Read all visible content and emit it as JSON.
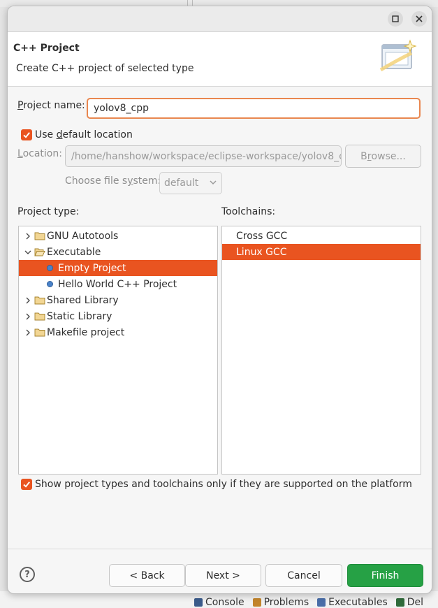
{
  "dialog": {
    "title": "C++ Project",
    "description": "Create C++ project of selected type"
  },
  "project_name": {
    "label_prefix": "P",
    "label_rest": "roject name:",
    "value": "yolov8_cpp"
  },
  "default_location": {
    "checked": true,
    "label_pre": "Use ",
    "label_u": "d",
    "label_post": "efault location"
  },
  "location": {
    "label_u": "L",
    "label_rest": "ocation:",
    "value": "/home/hanshow/workspace/eclipse-workspace/yolov8_c",
    "browse_u": "r",
    "browse_pre": "B",
    "browse_post": "owse..."
  },
  "file_system": {
    "label_pre": "Choose file s",
    "label_u": "y",
    "label_post": "stem:",
    "value": "default"
  },
  "project_type": {
    "label": "Project type:",
    "items": [
      {
        "label": "GNU Autotools",
        "kind": "folder",
        "expanded": false,
        "level": 0,
        "selected": false
      },
      {
        "label": "Executable",
        "kind": "folder",
        "expanded": true,
        "level": 0,
        "selected": false
      },
      {
        "label": "Empty Project",
        "kind": "leaf",
        "level": 1,
        "selected": true
      },
      {
        "label": "Hello World C++ Project",
        "kind": "leaf",
        "level": 1,
        "selected": false
      },
      {
        "label": "Shared Library",
        "kind": "folder",
        "expanded": false,
        "level": 0,
        "selected": false
      },
      {
        "label": "Static Library",
        "kind": "folder",
        "expanded": false,
        "level": 0,
        "selected": false
      },
      {
        "label": "Makefile project",
        "kind": "folder",
        "expanded": false,
        "level": 0,
        "selected": false
      }
    ]
  },
  "toolchains": {
    "label": "Toolchains:",
    "items": [
      {
        "label": "Cross GCC",
        "selected": false
      },
      {
        "label": "Linux GCC",
        "selected": true
      }
    ]
  },
  "supported_only": {
    "checked": true,
    "label": "Show project types and toolchains only if they are supported on the platform"
  },
  "buttons": {
    "help": "?",
    "back": "< Back",
    "next": "Next >",
    "cancel": "Cancel",
    "finish": "Finish"
  },
  "background_tabs": [
    {
      "label": "Console",
      "icon": "console-icon"
    },
    {
      "label": "Problems",
      "icon": "problems-icon"
    },
    {
      "label": "Executables",
      "icon": "executables-icon"
    },
    {
      "label": "Del",
      "icon": "debugger-icon"
    }
  ],
  "colors": {
    "accent": "#e95420",
    "focus_border": "#e9874f",
    "finish": "#26a145"
  }
}
